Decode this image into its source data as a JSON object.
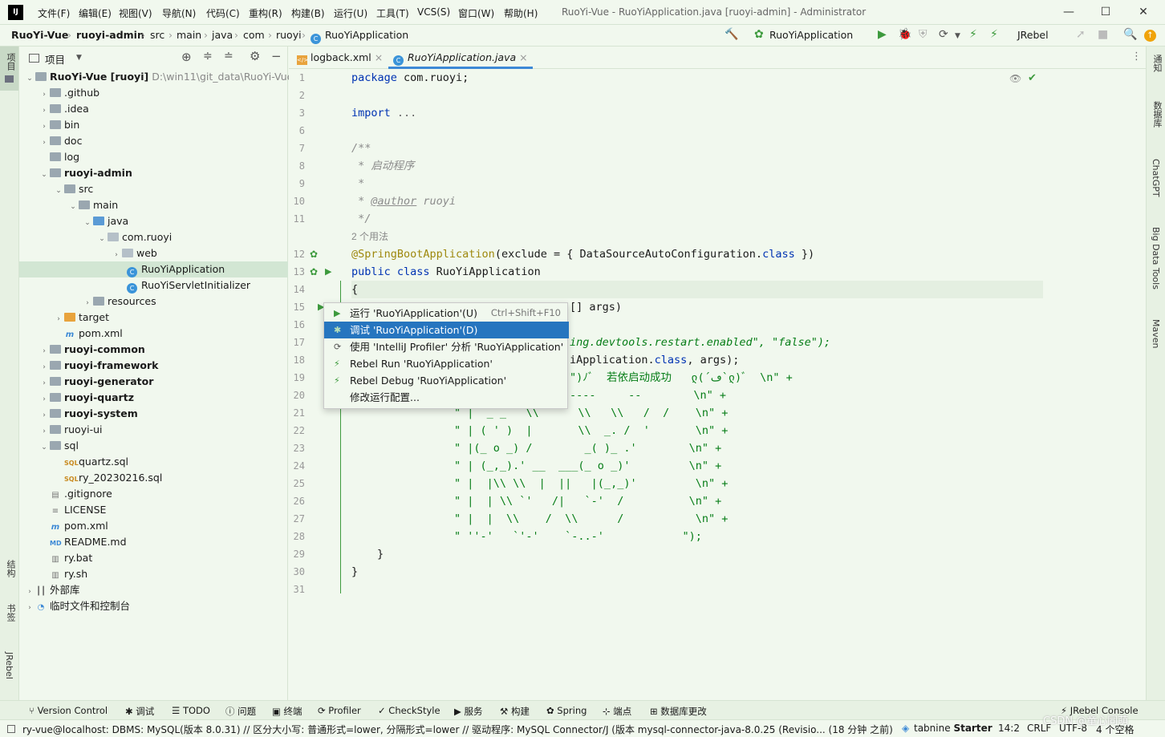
{
  "app": {
    "logo": "IJ",
    "title": "RuoYi-Vue - RuoYiApplication.java [ruoyi-admin] - Administrator"
  },
  "menu": [
    "文件(F)",
    "编辑(E)",
    "视图(V)",
    "导航(N)",
    "代码(C)",
    "重构(R)",
    "构建(B)",
    "运行(U)",
    "工具(T)",
    "VCS(S)",
    "窗口(W)",
    "帮助(H)"
  ],
  "window": {
    "minimize": "—",
    "maximize": "☐",
    "close": "✕"
  },
  "breadcrumb": [
    "RuoYi-Vue",
    "ruoyi-admin",
    "src",
    "main",
    "java",
    "com",
    "ruoyi",
    "RuoYiApplication"
  ],
  "toolbar": {
    "run_config": "RuoYiApplication",
    "jrebel": "JRebel"
  },
  "left_strip": {
    "project": "项目",
    "structure": "结构",
    "bookmarks": "书签",
    "jrebel": "JRebel"
  },
  "right_strip": {
    "notifications": "通知",
    "database": "数据库",
    "chatgpt": "ChatGPT",
    "bigdata": "Big Data Tools",
    "maven": "Maven"
  },
  "project_panel": {
    "title": "项目"
  },
  "tree": [
    {
      "label": "RuoYi-Vue [ruoyi]",
      "hint": "D:\\win11\\git_data\\RuoYi-Vue"
    },
    {
      "label": ".github"
    },
    {
      "label": ".idea"
    },
    {
      "label": "bin"
    },
    {
      "label": "doc"
    },
    {
      "label": "log"
    },
    {
      "label": "ruoyi-admin"
    },
    {
      "label": "src"
    },
    {
      "label": "main"
    },
    {
      "label": "java"
    },
    {
      "label": "com.ruoyi"
    },
    {
      "label": "web"
    },
    {
      "label": "RuoYiApplication"
    },
    {
      "label": "RuoYiServletInitializer"
    },
    {
      "label": "resources"
    },
    {
      "label": "target"
    },
    {
      "label": "pom.xml"
    },
    {
      "label": "ruoyi-common"
    },
    {
      "label": "ruoyi-framework"
    },
    {
      "label": "ruoyi-generator"
    },
    {
      "label": "ruoyi-quartz"
    },
    {
      "label": "ruoyi-system"
    },
    {
      "label": "ruoyi-ui"
    },
    {
      "label": "sql"
    },
    {
      "label": "quartz.sql"
    },
    {
      "label": "ry_20230216.sql"
    },
    {
      "label": ".gitignore"
    },
    {
      "label": "LICENSE"
    },
    {
      "label": "pom.xml"
    },
    {
      "label": "README.md"
    },
    {
      "label": "ry.bat"
    },
    {
      "label": "ry.sh"
    },
    {
      "label": "外部库"
    },
    {
      "label": "临时文件和控制台"
    }
  ],
  "tabs": [
    "logback.xml",
    "RuoYiApplication.java"
  ],
  "code": {
    "lines": [
      "1",
      "2",
      "3",
      "6",
      "7",
      "8",
      "9",
      "10",
      "11",
      "12",
      "13",
      "14",
      "15",
      "16",
      "17",
      "18",
      "19",
      "20",
      "21",
      "22",
      "23",
      "24",
      "25",
      "26",
      "27",
      "28",
      "29",
      "30",
      "31"
    ],
    "l1": "package com.ruoyi;",
    "l3": "import ...",
    "l7": "/**",
    "l8": " * 启动程序",
    "l9": " *",
    "l10a": " * ",
    "l10b": "@author",
    "l10c": " ruoyi",
    "l11": " */",
    "usages": "2 个用法",
    "l12a": "@SpringBootApplication",
    "l12b": "(exclude = { DataSourceAutoConfiguration.",
    "l12c": "class",
    "l12d": " })",
    "l13a": "public class",
    "l13b": " RuoYiApplication",
    "l14": "{",
    "l15": "[] args)",
    "l17": "ing.devtools.restart.enabled\", \"false\");",
    "l18a": "iApplication.",
    "l18b": "class",
    "l18c": ", args);",
    "l19": "\")ﾉﾞ  若依启动成功   ლ(´ڡ`ლ)ﾞ  \\n\" +",
    "l20": "----     --        \\n\" +",
    "l21": "\" |  _ _   \\\\      \\\\   \\\\   /  /    \\n\" +",
    "l22": "\" | ( ' )  |       \\\\  _. /  '       \\n\" +",
    "l23": "\" |(_ o _) /        _( )_ .'        \\n\" +",
    "l24": "\" | (_,_).' __  ___(_ o _)'         \\n\" +",
    "l25": "\" |  |\\\\ \\\\  |  ||   |(_,_)'         \\n\" +",
    "l26": "\" |  | \\\\ `'   /|   `-'  /          \\n\" +",
    "l27": "\" |  |  \\\\    /  \\\\      /           \\n\" +",
    "l28": "\" ''-'   `'-'    `-..-'            \");",
    "l29": "}",
    "l30": "}"
  },
  "popup": [
    {
      "label": "运行 'RuoYiApplication'(U)",
      "shortcut": "Ctrl+Shift+F10"
    },
    {
      "label": "调试 'RuoYiApplication'(D)"
    },
    {
      "label": "使用 'IntelliJ Profiler' 分析  'RuoYiApplication'"
    },
    {
      "label": "Rebel Run 'RuoYiApplication'"
    },
    {
      "label": "Rebel Debug 'RuoYiApplication'"
    },
    {
      "label": "修改运行配置..."
    }
  ],
  "bottom_tools": [
    "Version Control",
    "调试",
    "TODO",
    "问题",
    "终端",
    "Profiler",
    "CheckStyle",
    "服务",
    "构建",
    "Spring",
    "端点",
    "数据库更改",
    "JRebel Console"
  ],
  "status": {
    "message": "ry-vue@localhost: DBMS: MySQL(版本 8.0.31) // 区分大小写: 普通形式=lower, 分隔形式=lower // 驱动程序: MySQL Connector/J (版本 mysql-connector-java-8.0.25 (Revisio... (18 分钟 之前)",
    "tabnine": "tabnine",
    "tabnine_plan": "Starter",
    "position": "14:2",
    "line_sep": "CRLF",
    "encoding": "UTF-8",
    "indent": "4 个空格",
    "watermark": "CSDN @童心同萌"
  }
}
